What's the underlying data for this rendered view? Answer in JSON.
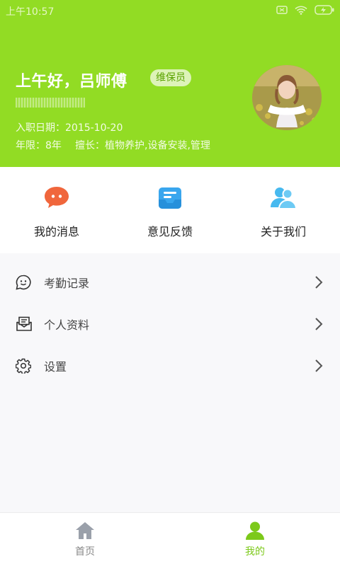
{
  "status_bar": {
    "time": "上午10:57"
  },
  "profile": {
    "greeting": "上午好，吕师傅",
    "role": "维保员",
    "hire_date": "入职日期：2015-10-20",
    "years": "年限：8年",
    "skills": "擅长：植物养护,设备安装,管理"
  },
  "quick_actions": [
    {
      "label": "我的消息",
      "icon": "chat-bubble-icon",
      "color": "#f0663c"
    },
    {
      "label": "意见反馈",
      "icon": "feedback-icon",
      "color": "#39a6ee"
    },
    {
      "label": "关于我们",
      "icon": "people-icon",
      "color": "#47b9ef"
    }
  ],
  "menu": [
    {
      "label": "考勤记录",
      "icon": "smiley-chat-icon"
    },
    {
      "label": "个人资料",
      "icon": "envelope-icon"
    },
    {
      "label": "设置",
      "icon": "gear-icon"
    }
  ],
  "bottom_nav": [
    {
      "label": "首页",
      "icon": "home-icon",
      "active": false
    },
    {
      "label": "我的",
      "icon": "user-icon",
      "active": true
    }
  ],
  "colors": {
    "accent": "#92dc24",
    "active_tab": "#7cc91a"
  }
}
